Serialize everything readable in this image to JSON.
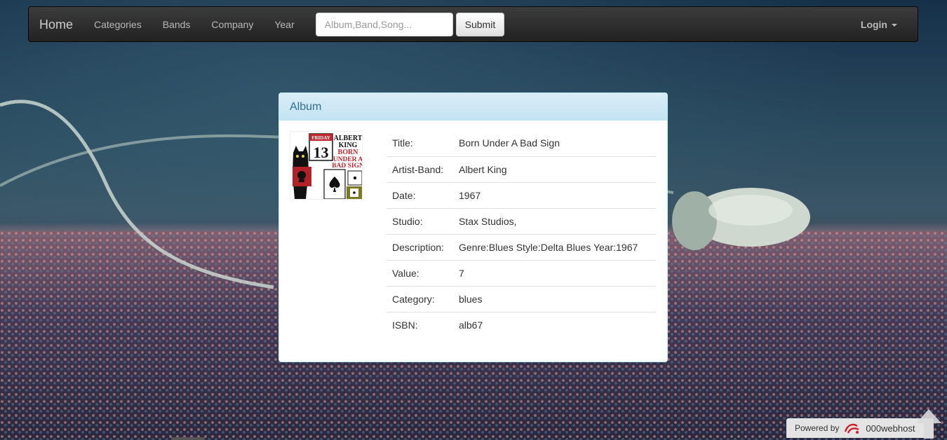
{
  "navbar": {
    "brand": "Home",
    "links": [
      "Categories",
      "Bands",
      "Company",
      "Year"
    ],
    "search": {
      "placeholder": "Album,Band,Song...",
      "value": ""
    },
    "submit_label": "Submit",
    "login_label": "Login"
  },
  "panel": {
    "heading": "Album",
    "cover": {
      "lines_top": [
        "ALBERT",
        "KING"
      ],
      "lines_red": [
        "BORN",
        "UNDER A",
        "BAD SIGN"
      ],
      "friday": "FRIDAY",
      "number": "13"
    },
    "details": [
      {
        "label": "Title:",
        "value": "Born Under A Bad Sign"
      },
      {
        "label": "Artist-Band:",
        "value": "Albert King"
      },
      {
        "label": "Date:",
        "value": "1967"
      },
      {
        "label": "Studio:",
        "value": "Stax Studios,"
      },
      {
        "label": "Description:",
        "value": "Genre:Blues Style:Delta Blues Year:1967"
      },
      {
        "label": "Value:",
        "value": "7"
      },
      {
        "label": "Category:",
        "value": "blues"
      },
      {
        "label": "ISBN:",
        "value": "alb67"
      }
    ]
  },
  "footer": {
    "powered_by": "Powered by",
    "host_name": "000webhost"
  },
  "icons": {
    "caret": "chevron-down-icon",
    "scroll_top": "arrow-up-icon",
    "host_logo": "host-logo-icon"
  }
}
